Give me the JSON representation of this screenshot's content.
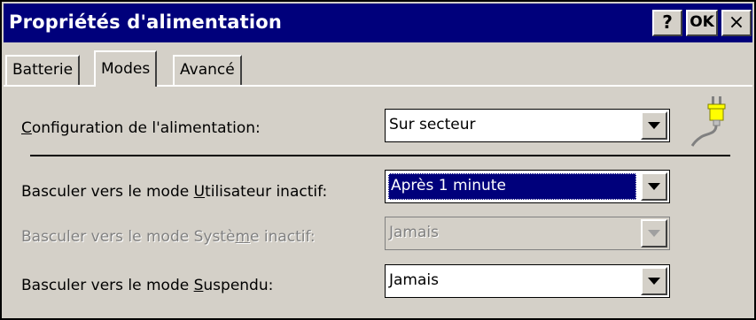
{
  "window": {
    "title": "Propriétés d'alimentation",
    "help_label": "?",
    "ok_label": "OK",
    "close_label": "×"
  },
  "tabs": [
    {
      "label": "Batterie",
      "active": false
    },
    {
      "label": "Modes",
      "active": true
    },
    {
      "label": "Avancé",
      "active": false
    }
  ],
  "power_config": {
    "label_pre": "",
    "label_key": "C",
    "label_post": "onfiguration de l'alimentation:",
    "value": "Sur secteur",
    "icon": "power-plug-icon"
  },
  "user_idle": {
    "label_pre": "Basculer vers le mode ",
    "label_key": "U",
    "label_post": "tilisateur inactif:",
    "value": "Après 1 minute"
  },
  "system_idle": {
    "label_pre": "Basculer vers le mode Systè",
    "label_key": "m",
    "label_post": "e inactif:",
    "value": "Jamais",
    "disabled": true
  },
  "suspend": {
    "label_pre": "Basculer vers le mode ",
    "label_key": "S",
    "label_post": "uspendu:",
    "value": "Jamais"
  },
  "colors": {
    "titlebar": "#00007b",
    "face": "#d4d0c8",
    "selection": "#00007b"
  }
}
